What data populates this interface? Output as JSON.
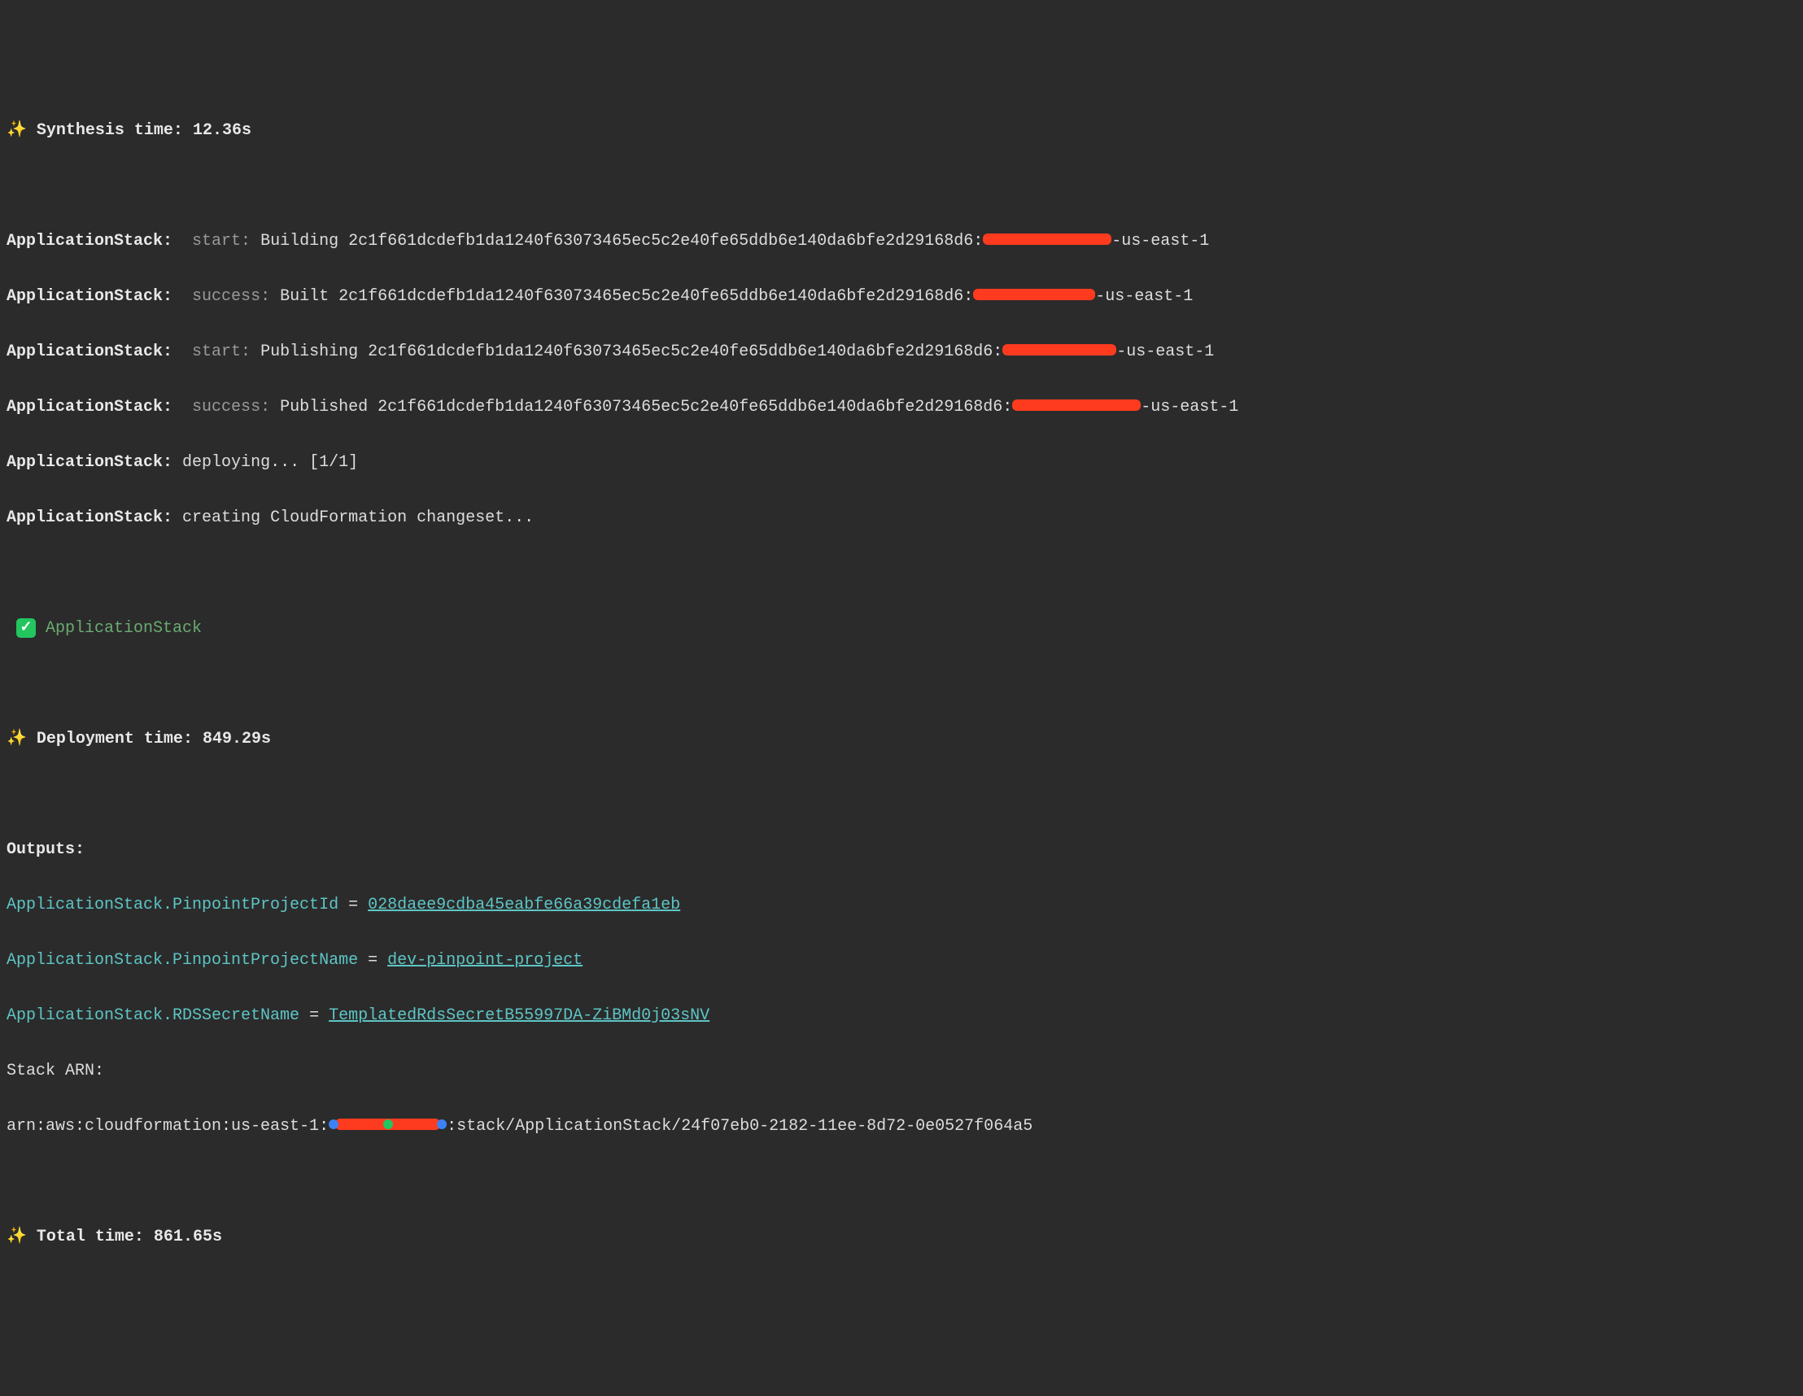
{
  "synthesis": {
    "sparkle": "✨",
    "label": " Synthesis time: 12.36s"
  },
  "build_lines": [
    {
      "stack": "ApplicationStack:",
      "status": "  start:",
      "action": " Building 2c1f661dcdefb1da1240f63073465ec5c2e40fe65ddb6e140da6bfe2d29168d6:",
      "region": "-us-east-1",
      "redact_class": "redact-wide"
    },
    {
      "stack": "ApplicationStack:",
      "status": "  success:",
      "action": " Built 2c1f661dcdefb1da1240f63073465ec5c2e40fe65ddb6e140da6bfe2d29168d6:",
      "region": "-us-east-1",
      "redact_class": "redact-narrow"
    },
    {
      "stack": "ApplicationStack:",
      "status": "  start:",
      "action": " Publishing 2c1f661dcdefb1da1240f63073465ec5c2e40fe65ddb6e140da6bfe2d29168d6:",
      "region": "-us-east-1",
      "redact_class": "redact-narrower"
    },
    {
      "stack": "ApplicationStack:",
      "status": "  success:",
      "action": " Published 2c1f661dcdefb1da1240f63073465ec5c2e40fe65ddb6e140da6bfe2d29168d6:",
      "region": "-us-east-1",
      "redact_class": "redact-wide"
    }
  ],
  "deploying": {
    "stack": "ApplicationStack:",
    "text": " deploying... [1/1]"
  },
  "changeset": {
    "stack": "ApplicationStack:",
    "text": " creating CloudFormation changeset..."
  },
  "success_stack": {
    "check": "✓",
    "name": " ApplicationStack"
  },
  "deployment": {
    "sparkle": "✨",
    "label": " Deployment time: 849.29s"
  },
  "outputs_label": "Outputs:",
  "outputs": [
    {
      "key": "ApplicationStack.PinpointProjectId",
      "eq": " = ",
      "value": "028daee9cdba45eabfe66a39cdefa1eb"
    },
    {
      "key": "ApplicationStack.PinpointProjectName",
      "eq": " = ",
      "value": "dev-pinpoint-project"
    },
    {
      "key": "ApplicationStack.RDSSecretName",
      "eq": " = ",
      "value": "TemplatedRdsSecretB55997DA-ZiBMd0j03sNV"
    }
  ],
  "stack_arn_label": "Stack ARN:",
  "stack_arn": {
    "prefix": "arn:aws:cloudformation:us-east-1:",
    "suffix": ":stack/ApplicationStack/24f07eb0-2182-11ee-8d72-0e0527f064a5"
  },
  "total": {
    "sparkle": "✨",
    "label": " Total time: 861.65s"
  }
}
